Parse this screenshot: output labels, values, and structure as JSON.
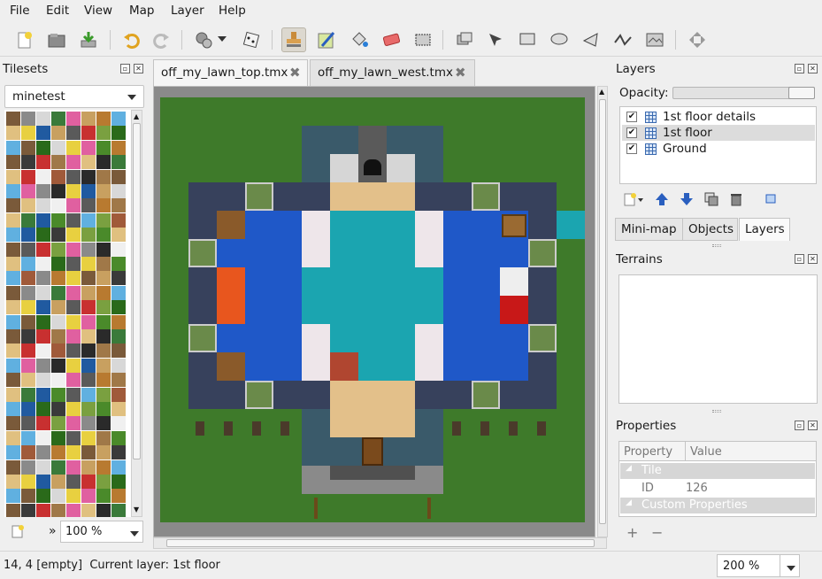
{
  "menu": [
    "File",
    "Edit",
    "View",
    "Map",
    "Layer",
    "Help"
  ],
  "toolbar": {
    "icons": [
      "new-map-icon",
      "open-icon",
      "save-icon",
      "undo-icon",
      "redo-icon",
      "command-icon",
      "random-dice-icon",
      "stamp-brush-icon",
      "terrain-brush-icon",
      "bucket-fill-icon",
      "eraser-icon",
      "rectangle-select-icon",
      "select-objects-icon",
      "edit-polygons-icon",
      "insert-rectangle-icon",
      "insert-ellipse-icon",
      "insert-polygon-icon",
      "insert-polyline-icon",
      "insert-tile-icon",
      "zoom-fit-icon"
    ]
  },
  "tilesets_panel": {
    "title": "Tilesets",
    "selected_tileset": "minetest",
    "zoom": "100 %"
  },
  "tabs": [
    {
      "label": "off_my_lawn_top.tmx",
      "active": true
    },
    {
      "label": "off_my_lawn_west.tmx",
      "active": false
    }
  ],
  "layers_panel": {
    "title": "Layers",
    "opacity_label": "Opacity:",
    "opacity": 1.0,
    "layers": [
      {
        "name": "1st floor details",
        "visible": true,
        "selected": false
      },
      {
        "name": "1st floor",
        "visible": true,
        "selected": true
      },
      {
        "name": "Ground",
        "visible": true,
        "selected": false
      }
    ]
  },
  "right_tabs": [
    "Mini-map",
    "Objects",
    "Layers"
  ],
  "active_right_tab": "Layers",
  "terrains_panel": {
    "title": "Terrains"
  },
  "properties_panel": {
    "title": "Properties",
    "columns": [
      "Property",
      "Value"
    ],
    "groups": [
      {
        "label": "Tile",
        "rows": [
          {
            "name": "ID",
            "value": "126"
          }
        ]
      },
      {
        "label": "Custom Properties",
        "rows": []
      }
    ]
  },
  "status": {
    "text": "14, 4 [empty]  Current layer: 1st floor",
    "zoom": "200 %"
  },
  "colors": {
    "grass": "#3e7a2a",
    "water": "#1f58c8",
    "cyan_water": "#1ba5b0",
    "stone": "#3a4a6a",
    "wood": "#e3c08a"
  }
}
